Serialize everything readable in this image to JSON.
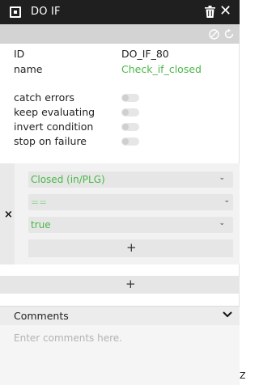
{
  "titlebar": {
    "title": "DO IF",
    "icon": "block-icon"
  },
  "toolbar": {
    "icons": [
      "disable-icon",
      "reset-icon"
    ]
  },
  "properties": {
    "id_label": "ID",
    "id_value": "DO_IF_80",
    "name_label": "name",
    "name_value": "Check_if_closed"
  },
  "options": [
    {
      "label": "catch errors",
      "enabled": false
    },
    {
      "label": "keep evaluating",
      "enabled": false
    },
    {
      "label": "invert condition",
      "enabled": false
    },
    {
      "label": "stop on failure",
      "enabled": false
    }
  ],
  "condition": {
    "remove_label": "×",
    "left_operand": "Closed (in/PLG)",
    "operator": "==",
    "right_operand": "true",
    "add_operand_label": "+"
  },
  "add_condition_label": "+",
  "comments": {
    "title": "Comments",
    "placeholder": "Enter comments here.",
    "value": ""
  },
  "corner_text": "Z",
  "colors": {
    "accent": "#49b749",
    "titlebar": "#1f1f1f",
    "toolbar": "#d3d3d3"
  }
}
